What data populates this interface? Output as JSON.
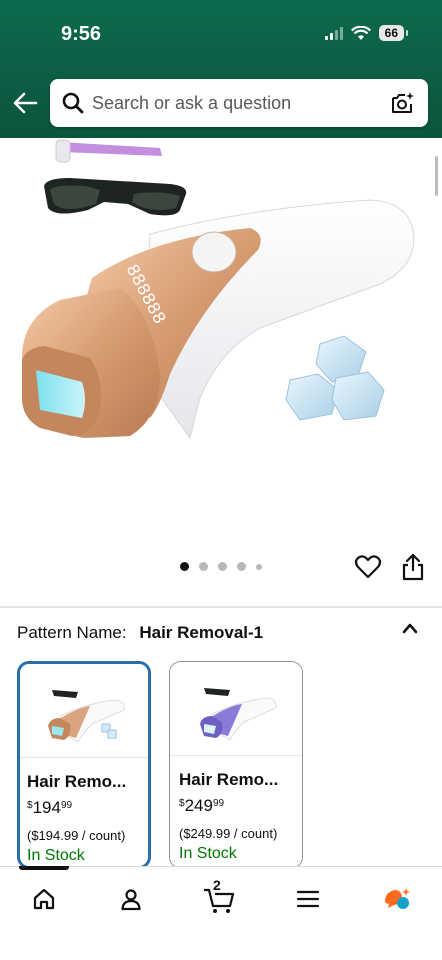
{
  "status_bar": {
    "time": "9:56",
    "battery": "66"
  },
  "search": {
    "placeholder": "Search or ask a question"
  },
  "gallery": {
    "dot_count": 5,
    "active_dot": 1
  },
  "pattern": {
    "label": "Pattern Name:",
    "value": "Hair Removal-1"
  },
  "options": [
    {
      "title": "Hair Remo...",
      "currency": "$",
      "price_whole": "194",
      "price_cents": "99",
      "unit_price": "($194.99 / count)",
      "stock": "In Stock",
      "selected": true
    },
    {
      "title": "Hair Remo...",
      "currency": "$",
      "price_whole": "249",
      "price_cents": "99",
      "unit_price": "($249.99 / count)",
      "stock": "In Stock",
      "selected": false
    }
  ],
  "nav": {
    "cart_count": "2",
    "items": [
      "home-icon",
      "account-icon",
      "cart-icon",
      "menu-icon",
      "rufus-icon"
    ]
  },
  "colors": {
    "header": "#0b6b4d",
    "selected_border": "#2a6fa8",
    "in_stock": "#007600",
    "device_rose_gold": "#d9a47f",
    "device_purple": "#8c7ad8"
  }
}
